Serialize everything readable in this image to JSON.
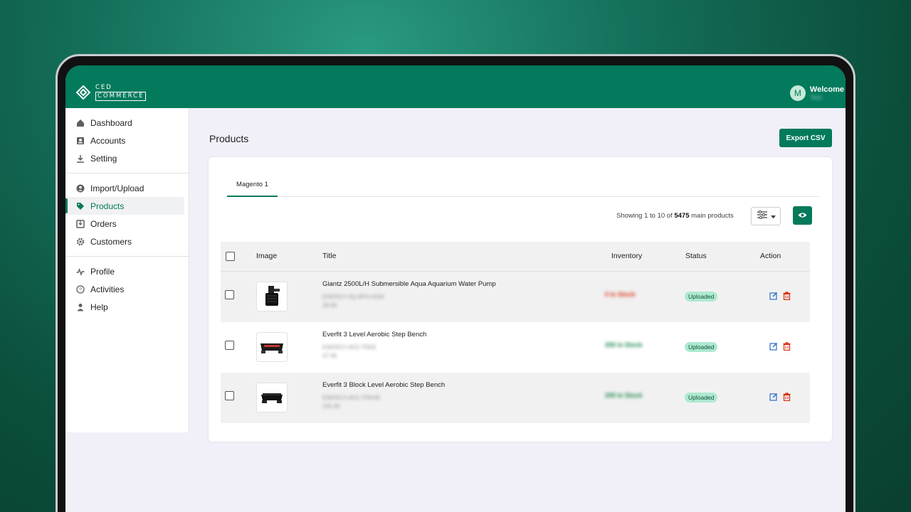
{
  "brand": {
    "line1": "CED",
    "line2": "COMMERCE"
  },
  "user": {
    "avatar_initial": "M",
    "welcome": "Welcome",
    "name": "Test"
  },
  "sidebar": {
    "groups": [
      [
        {
          "label": "Dashboard",
          "icon": "home-icon"
        },
        {
          "label": "Accounts",
          "icon": "accounts-icon"
        },
        {
          "label": "Setting",
          "icon": "download-icon"
        }
      ],
      [
        {
          "label": "Import/Upload",
          "icon": "import-icon"
        },
        {
          "label": "Products",
          "icon": "tag-icon",
          "active": true
        },
        {
          "label": "Orders",
          "icon": "orders-icon"
        },
        {
          "label": "Customers",
          "icon": "gear-icon"
        }
      ],
      [
        {
          "label": "Profile",
          "icon": "activity-icon"
        },
        {
          "label": "Activities",
          "icon": "help-circle-icon"
        },
        {
          "label": "Help",
          "icon": "person-icon"
        }
      ]
    ]
  },
  "page": {
    "title": "Products",
    "export_label": "Export CSV"
  },
  "tabs": [
    {
      "label": "Magento 1"
    }
  ],
  "summary": {
    "prefix": "Showing 1 to 10 of",
    "total": "5475",
    "suffix": "main products"
  },
  "table": {
    "columns": {
      "image": "Image",
      "title": "Title",
      "inventory": "Inventory",
      "status": "Status",
      "action": "Action"
    },
    "rows": [
      {
        "title": "Giantz 2500L/H Submersible Aqua Aquarium Water Pump",
        "sku": "ENERGY-AQ-BPH-4200",
        "price": "28.99",
        "inventory": "0 in Stock",
        "status": "Uploaded",
        "product_icon": "water-pump-image"
      },
      {
        "title": "Everfit 3 Level Aerobic Step Bench",
        "sku": "ENERGY-AKS-TRKE",
        "price": "47.99",
        "inventory": "200 in Stock",
        "status": "Uploaded",
        "product_icon": "step-bench-image"
      },
      {
        "title": "Everfit 3 Block Level Aerobic Step Bench",
        "sku": "ENERGY-AKS-TRKHE",
        "price": "105.99",
        "inventory": "200 in Stock",
        "status": "Uploaded",
        "product_icon": "block-step-bench-image"
      }
    ]
  },
  "colors": {
    "brand": "#037a5c",
    "out_of_stock": "#d82c0d",
    "in_stock": "#108043",
    "edit": "#2c6ecb",
    "delete": "#d82c0d"
  }
}
